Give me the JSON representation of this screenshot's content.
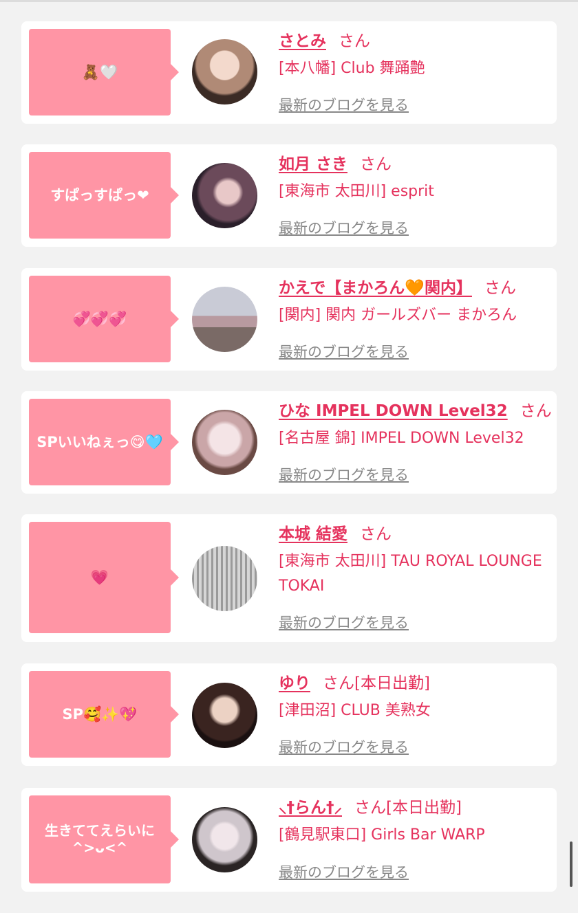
{
  "theme": {
    "accent": "#e5325d",
    "bubble": "#ff95a5",
    "card": "#ffffff",
    "background": "#f2f2f2"
  },
  "posts": [
    {
      "bubble_text": "🧸🤍",
      "name": "さとみ",
      "honorific": "さん",
      "shop": "[本八幡] Club 舞踊艶",
      "blog_link": "最新のブログを見る"
    },
    {
      "bubble_text": "すぱっすぱっ❤",
      "name": "如月 さき",
      "honorific": "さん",
      "shop": "[東海市 太田川] esprit",
      "blog_link": "最新のブログを見る"
    },
    {
      "bubble_text": "💞💞💞",
      "name": "かえで【まかろん🧡関内】",
      "honorific": "さん",
      "shop": "[関内] 関内 ガールズバー まかろん",
      "blog_link": "最新のブログを見る"
    },
    {
      "bubble_text": "SPいいねぇっ😋🩵",
      "name": "ひな IMPEL DOWN Level32",
      "honorific": "さん",
      "shop": "[名古屋 錦] IMPEL DOWN Level32",
      "blog_link": "最新のブログを見る"
    },
    {
      "bubble_text": "💗",
      "name": "本城 結愛",
      "honorific": "さん",
      "shop": "[東海市 太田川] TAU ROYAL LOUNGE TOKAI",
      "blog_link": "最新のブログを見る"
    },
    {
      "bubble_text": "SP🥰✨💖",
      "name": "ゆり",
      "honorific": "さん[本日出勤]",
      "shop": "[津田沼] CLUB 美熟女",
      "blog_link": "最新のブログを見る"
    },
    {
      "bubble_text": "生きててえらいに ^>ᴗ<^",
      "name": "⸜†らん†⸝",
      "honorific": "さん[本日出勤]",
      "shop": "[鶴見駅東口] Girls Bar WARP",
      "blog_link": "最新のブログを見る"
    }
  ]
}
